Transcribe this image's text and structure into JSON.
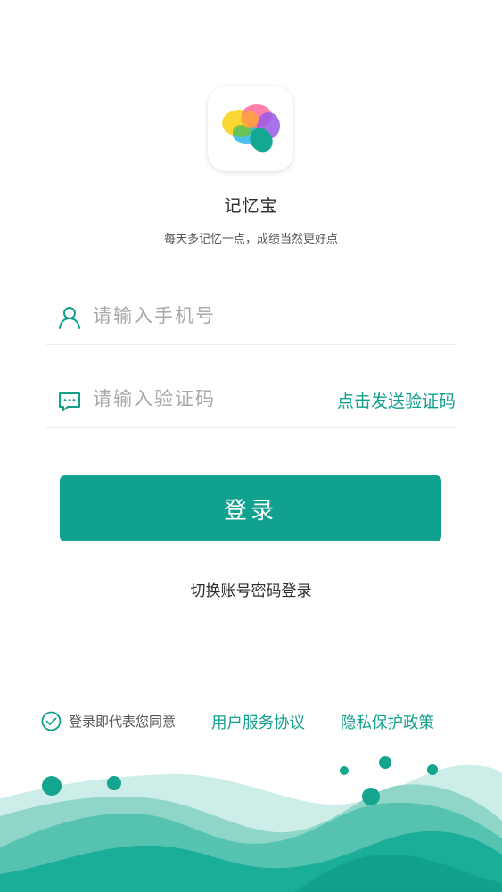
{
  "app": {
    "name": "记忆宝",
    "slogan": "每天多记忆一点，成绩当然更好点",
    "logo_icon": "colorful-brain-icon"
  },
  "form": {
    "phone": {
      "icon": "user-icon",
      "placeholder": "请输入手机号",
      "value": ""
    },
    "code": {
      "icon": "message-icon",
      "placeholder": "请输入验证码",
      "value": "",
      "send_label": "点击发送验证码"
    }
  },
  "login_button": "登录",
  "switch_login": "切换账号密码登录",
  "agreement": {
    "checked": true,
    "check_icon": "check-circle-icon",
    "prefix": "登录即代表您同意",
    "service_link": "用户服务协议",
    "privacy_link": "隐私保护政策"
  },
  "colors": {
    "accent": "#12a08d",
    "button": "#10a28e",
    "wave_light": "#c9ece6",
    "wave_mid": "#7fd0c2",
    "wave_dark": "#1aae98"
  }
}
